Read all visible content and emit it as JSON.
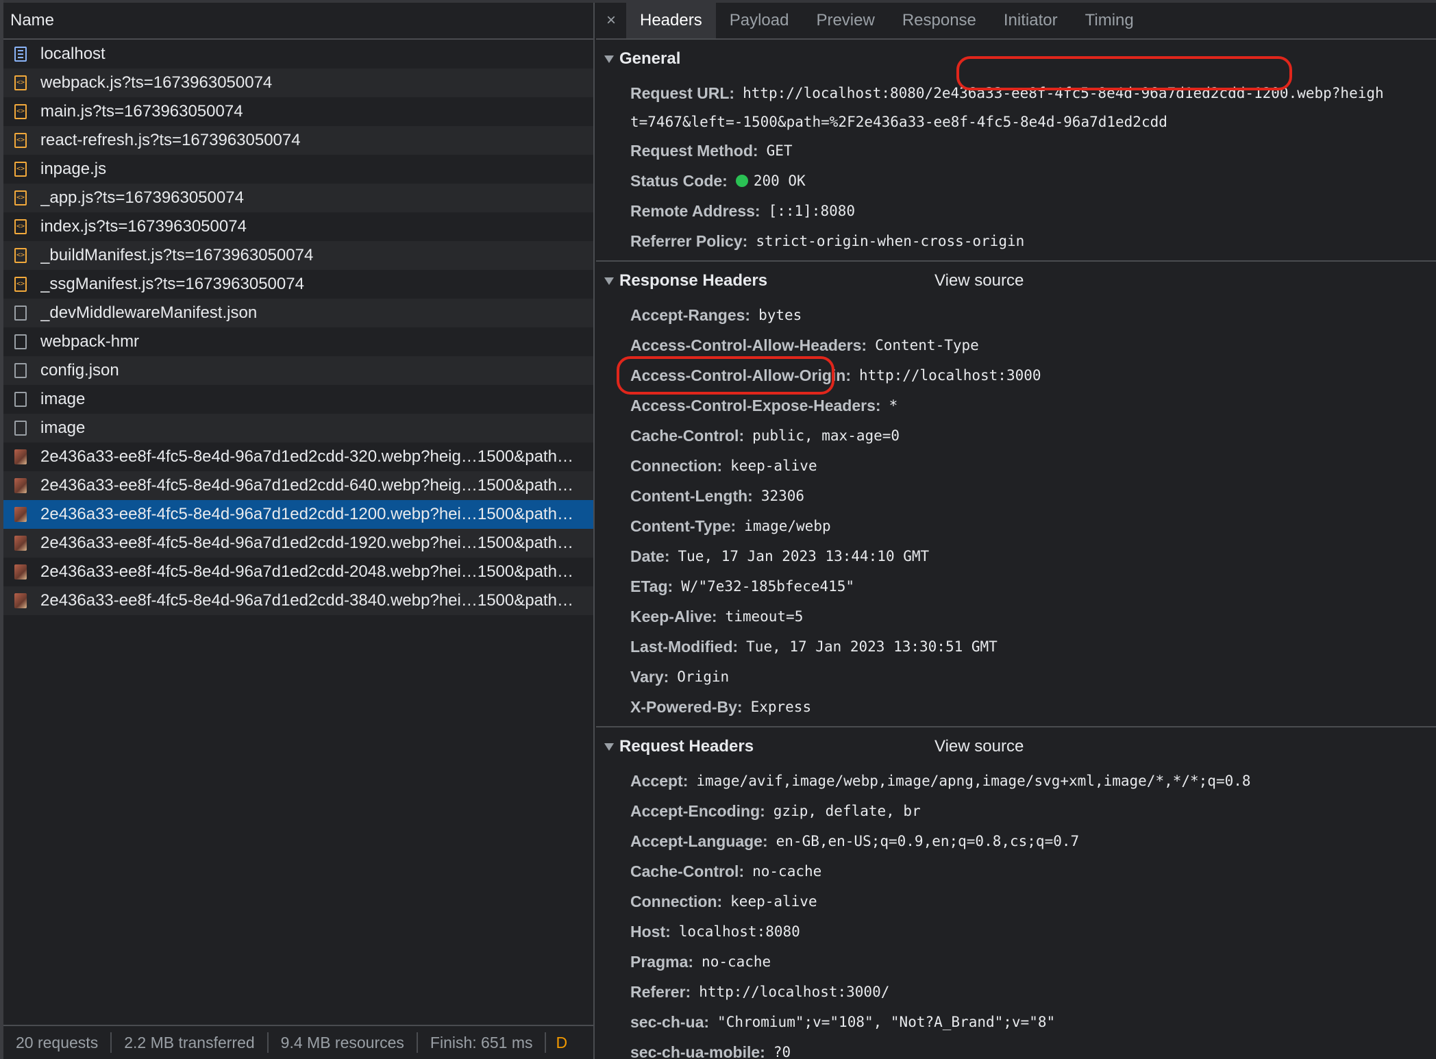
{
  "left": {
    "column_header": "Name",
    "rows": [
      {
        "icon": "document-icon",
        "label": "localhost"
      },
      {
        "icon": "script-icon",
        "label": "webpack.js?ts=1673963050074"
      },
      {
        "icon": "script-icon",
        "label": "main.js?ts=1673963050074"
      },
      {
        "icon": "script-icon",
        "label": "react-refresh.js?ts=1673963050074"
      },
      {
        "icon": "script-icon",
        "label": "inpage.js"
      },
      {
        "icon": "script-icon",
        "label": "_app.js?ts=1673963050074"
      },
      {
        "icon": "script-icon",
        "label": "index.js?ts=1673963050074"
      },
      {
        "icon": "script-icon",
        "label": "_buildManifest.js?ts=1673963050074"
      },
      {
        "icon": "script-icon",
        "label": "_ssgManifest.js?ts=1673963050074"
      },
      {
        "icon": "file-icon",
        "label": "_devMiddlewareManifest.json"
      },
      {
        "icon": "file-icon",
        "label": "webpack-hmr"
      },
      {
        "icon": "file-icon",
        "label": "config.json"
      },
      {
        "icon": "file-icon",
        "label": "image"
      },
      {
        "icon": "file-icon",
        "label": "image"
      },
      {
        "icon": "image-icon",
        "label": "2e436a33-ee8f-4fc5-8e4d-96a7d1ed2cdd-320.webp?heig…1500&path…"
      },
      {
        "icon": "image-icon",
        "label": "2e436a33-ee8f-4fc5-8e4d-96a7d1ed2cdd-640.webp?heig…1500&path…"
      },
      {
        "icon": "image-icon",
        "label": "2e436a33-ee8f-4fc5-8e4d-96a7d1ed2cdd-1200.webp?hei…1500&path…",
        "selected": true
      },
      {
        "icon": "image-icon",
        "label": "2e436a33-ee8f-4fc5-8e4d-96a7d1ed2cdd-1920.webp?hei…1500&path…"
      },
      {
        "icon": "image-icon",
        "label": "2e436a33-ee8f-4fc5-8e4d-96a7d1ed2cdd-2048.webp?hei…1500&path…"
      },
      {
        "icon": "image-icon",
        "label": "2e436a33-ee8f-4fc5-8e4d-96a7d1ed2cdd-3840.webp?hei…1500&path…"
      }
    ],
    "status": {
      "requests": "20 requests",
      "transferred": "2.2 MB transferred",
      "resources": "9.4 MB resources",
      "finish": "Finish: 651 ms",
      "trailing": "D"
    }
  },
  "right": {
    "close_label": "×",
    "tabs": [
      "Headers",
      "Payload",
      "Preview",
      "Response",
      "Initiator",
      "Timing"
    ],
    "active_tab": "Headers",
    "general": {
      "title": "General",
      "request_url_key": "Request URL:",
      "request_url_line1": "http://localhost:8080/2e436a33-ee8f-4fc5-8e4d-96a7d1ed2cdd-1200.webp?heigh",
      "request_url_line2": "t=7467&left=-1500&path=%2F2e436a33-ee8f-4fc5-8e4d-96a7d1ed2cdd",
      "items": [
        {
          "key": "Request Method:",
          "value": "GET"
        },
        {
          "key": "Status Code:",
          "value": "200 OK",
          "status_dot": true
        },
        {
          "key": "Remote Address:",
          "value": "[::1]:8080"
        },
        {
          "key": "Referrer Policy:",
          "value": "strict-origin-when-cross-origin"
        }
      ]
    },
    "response_headers": {
      "title": "Response Headers",
      "view_source": "View source",
      "items": [
        {
          "key": "Accept-Ranges:",
          "value": "bytes"
        },
        {
          "key": "Access-Control-Allow-Headers:",
          "value": "Content-Type"
        },
        {
          "key": "Access-Control-Allow-Origin:",
          "value": "http://localhost:3000"
        },
        {
          "key": "Access-Control-Expose-Headers:",
          "value": "*"
        },
        {
          "key": "Cache-Control:",
          "value": "public, max-age=0"
        },
        {
          "key": "Connection:",
          "value": "keep-alive"
        },
        {
          "key": "Content-Length:",
          "value": "32306"
        },
        {
          "key": "Content-Type:",
          "value": "image/webp"
        },
        {
          "key": "Date:",
          "value": "Tue, 17 Jan 2023 13:44:10 GMT"
        },
        {
          "key": "ETag:",
          "value": "W/\"7e32-185bfece415\""
        },
        {
          "key": "Keep-Alive:",
          "value": "timeout=5"
        },
        {
          "key": "Last-Modified:",
          "value": "Tue, 17 Jan 2023 13:30:51 GMT"
        },
        {
          "key": "Vary:",
          "value": "Origin"
        },
        {
          "key": "X-Powered-By:",
          "value": "Express"
        }
      ]
    },
    "request_headers": {
      "title": "Request Headers",
      "view_source": "View source",
      "items": [
        {
          "key": "Accept:",
          "value": "image/avif,image/webp,image/apng,image/svg+xml,image/*,*/*;q=0.8"
        },
        {
          "key": "Accept-Encoding:",
          "value": "gzip, deflate, br"
        },
        {
          "key": "Accept-Language:",
          "value": "en-GB,en-US;q=0.9,en;q=0.8,cs;q=0.7"
        },
        {
          "key": "Cache-Control:",
          "value": "no-cache"
        },
        {
          "key": "Connection:",
          "value": "keep-alive"
        },
        {
          "key": "Host:",
          "value": "localhost:8080"
        },
        {
          "key": "Pragma:",
          "value": "no-cache"
        },
        {
          "key": "Referer:",
          "value": "http://localhost:3000/"
        },
        {
          "key": "sec-ch-ua:",
          "value": "\"Chromium\";v=\"108\", \"Not?A_Brand\";v=\"8\""
        },
        {
          "key": "sec-ch-ua-mobile:",
          "value": "?0"
        }
      ]
    }
  },
  "colors": {
    "background": "#202124",
    "selected_row": "#0b5394",
    "highlight_annotation": "#e0261b",
    "status_ok": "#2ac154"
  }
}
